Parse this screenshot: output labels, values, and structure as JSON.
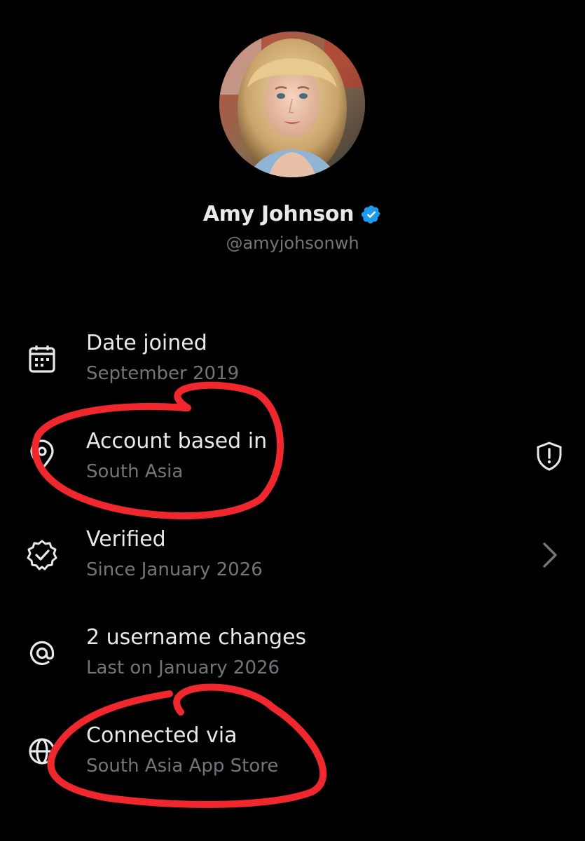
{
  "profile": {
    "name": "Amy Johnson",
    "handle": "@amyjohsonwh",
    "verified_color": "#1d9bf0"
  },
  "details": [
    {
      "icon": "calendar-icon",
      "title": "Date joined",
      "subtitle": "September 2019"
    },
    {
      "icon": "location-pin-icon",
      "title": "Account based in",
      "subtitle": "South Asia",
      "trailing_icon": "shield-alert-icon"
    },
    {
      "icon": "verified-check-icon",
      "title": "Verified",
      "subtitle": "Since January 2026",
      "trailing_icon": "chevron-right-icon"
    },
    {
      "icon": "at-sign-icon",
      "title": "2 username changes",
      "subtitle": "Last on January 2026"
    },
    {
      "icon": "globe-icon",
      "title": "Connected via",
      "subtitle": "South Asia App Store"
    }
  ],
  "colors": {
    "background": "#000000",
    "primary_text": "#e7e9ea",
    "secondary_text": "#71767b",
    "annotation_red": "#f0282d"
  }
}
